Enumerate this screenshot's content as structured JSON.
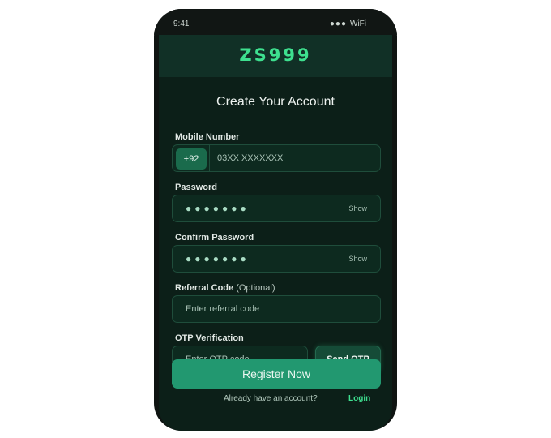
{
  "status_bar": {
    "time": "9:41",
    "signal": "●●●",
    "network": "WiFi"
  },
  "brand": {
    "name": "ZS999",
    "color": "#3ee08f"
  },
  "page_title": "Create Your Account",
  "form": {
    "mobile": {
      "label": "Mobile Number",
      "country_code": "+92",
      "placeholder": "03XX XXXXXXX"
    },
    "password": {
      "label": "Password",
      "masked_value": "●●●●●●●",
      "toggle_label": "Show"
    },
    "confirm_password": {
      "label": "Confirm Password",
      "masked_value": "●●●●●●●",
      "toggle_label": "Show"
    },
    "referral": {
      "label": "Referral Code",
      "optional_note": "(Optional)",
      "placeholder": "Enter referral code"
    },
    "otp": {
      "label": "OTP Verification",
      "placeholder": "Enter OTP code",
      "send_button": "Send OTP"
    },
    "submit_label": "Register Now"
  },
  "footer": {
    "prompt": "Already have an account?",
    "login_link": "Login"
  },
  "colors": {
    "accent": "#3ee08f",
    "primary_button": "#229870",
    "background": "#0c1f18"
  }
}
